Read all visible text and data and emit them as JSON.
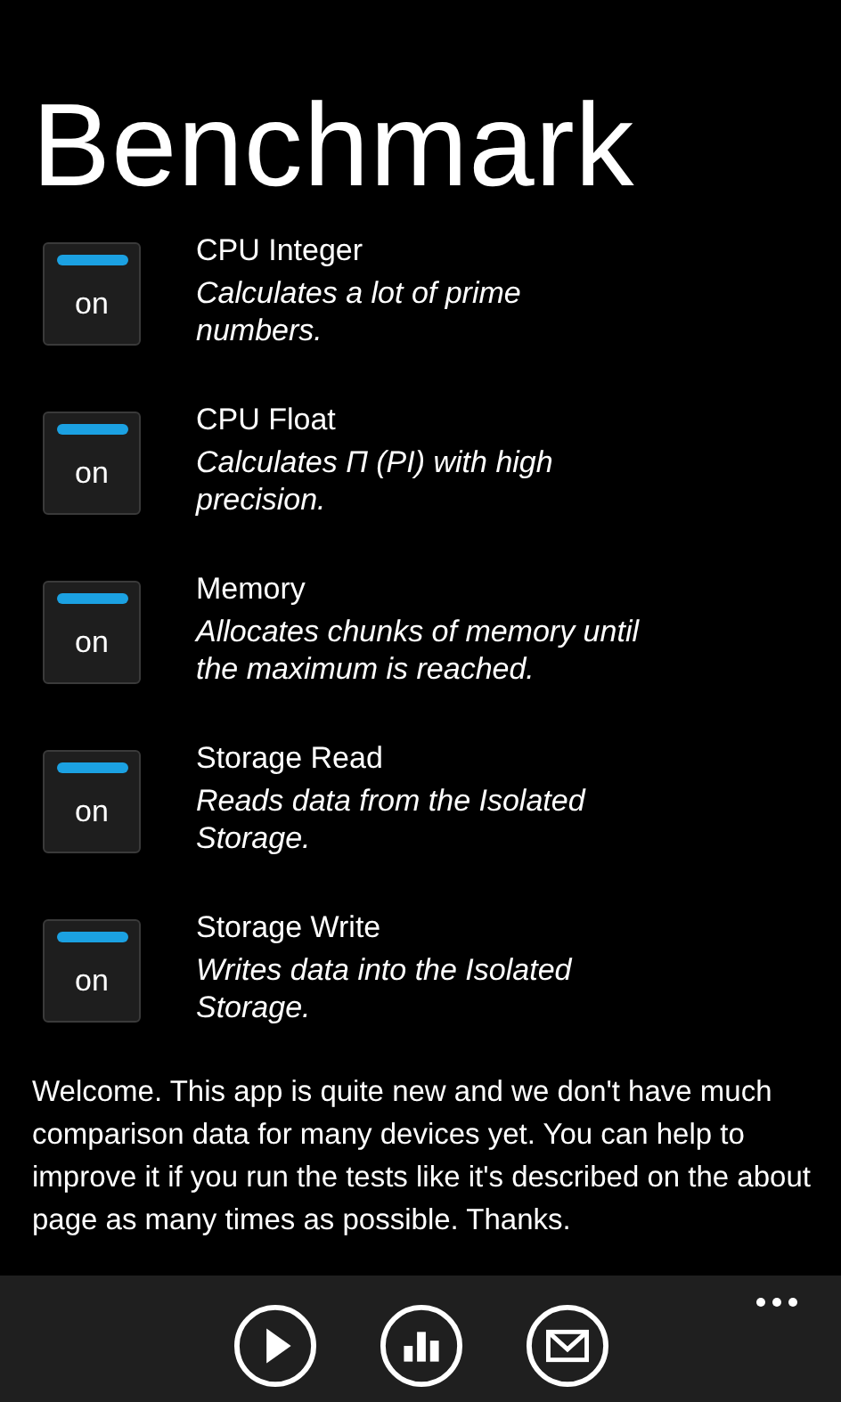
{
  "title": "Benchmark",
  "tests": [
    {
      "name": "CPU Integer",
      "description": "Calculates a lot of prime numbers.",
      "toggle": "on",
      "checked": true
    },
    {
      "name": "CPU Float",
      "description": "Calculates Π (PI) with high precision.",
      "toggle": "on",
      "checked": true
    },
    {
      "name": "Memory",
      "description": "Allocates chunks of memory until the maximum is reached.",
      "toggle": "on",
      "checked": true
    },
    {
      "name": "Storage Read",
      "description": "Reads data from the Isolated Storage.",
      "toggle": "on",
      "checked": true
    },
    {
      "name": "Storage Write",
      "description": "Writes data into the Isolated Storage.",
      "toggle": "on",
      "checked": true
    }
  ],
  "welcome": "Welcome. This app is quite new and we don't have much comparison data for many devices yet. You can help to improve it if you run the tests like it's described on the about page as many times as possible. Thanks.",
  "app_bar": {
    "buttons": [
      {
        "kind": "play"
      },
      {
        "kind": "chart"
      },
      {
        "kind": "mail"
      }
    ]
  }
}
